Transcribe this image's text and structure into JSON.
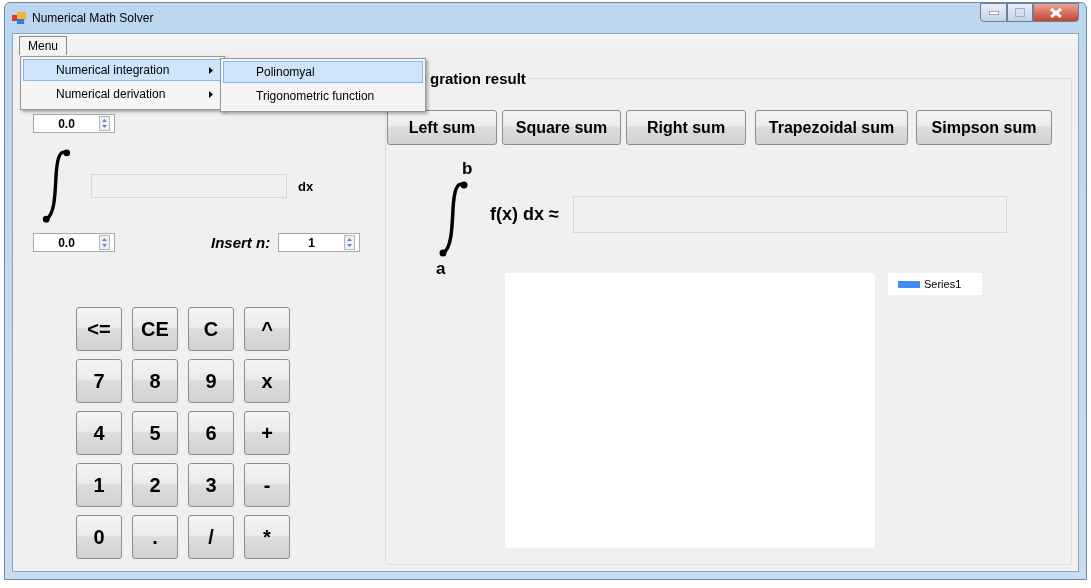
{
  "window": {
    "title": "Numerical Math Solver"
  },
  "menu_bar": [
    {
      "label": "Menu",
      "selected": true
    }
  ],
  "menu": [
    {
      "label": "Numerical integration",
      "selected": true,
      "submenu": true,
      "children": [
        {
          "label": "Polinomyal",
          "selected": true
        },
        {
          "label": "Trigonometric function",
          "selected": false
        }
      ]
    },
    {
      "label": "Numerical derivation",
      "selected": false,
      "submenu": true
    }
  ],
  "integral": {
    "upper": "0.0",
    "lower": "0.0",
    "suffix": "dx",
    "n_label": "Insert n:",
    "n_value": "1"
  },
  "keypad": [
    "<=",
    "CE",
    "C",
    "^",
    "7",
    "8",
    "9",
    "x",
    "4",
    "5",
    "6",
    "+",
    "1",
    "2",
    "3",
    "-",
    "0",
    ".",
    "/",
    "*"
  ],
  "result": {
    "title": "gration result",
    "buttons": [
      "Left sum",
      "Square sum",
      "Right sum",
      "Trapezoidal sum",
      "Simpson sum"
    ],
    "upper_label": "b",
    "lower_label": "a",
    "expression": "f(x) dx ≈",
    "legend": [
      "Series1"
    ]
  }
}
